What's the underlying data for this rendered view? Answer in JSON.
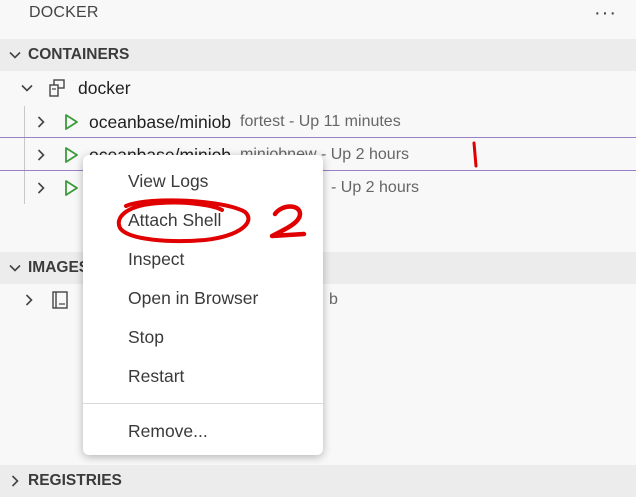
{
  "panel": {
    "title": "DOCKER",
    "more_glyph": "···"
  },
  "sections": {
    "containers": {
      "label": "CONTAINERS"
    },
    "images": {
      "label": "IMAGES"
    },
    "registries": {
      "label": "REGISTRIES"
    }
  },
  "containers_group": {
    "label": "docker"
  },
  "containers": [
    {
      "name": "oceanbase/miniob",
      "desc": "fortest - Up 11 minutes"
    },
    {
      "name": "oceanbase/miniob",
      "desc": "miniobnew - Up 2 hours"
    },
    {
      "name": "",
      "desc": "- Up 2 hours"
    }
  ],
  "images": [
    {
      "name": "",
      "desc": "b"
    }
  ],
  "context_menu": {
    "items": [
      {
        "label": "View Logs"
      },
      {
        "label": "Attach Shell"
      },
      {
        "label": "Inspect"
      },
      {
        "label": "Open in Browser"
      },
      {
        "label": "Stop"
      },
      {
        "label": "Restart"
      }
    ],
    "footer_item": {
      "label": "Remove..."
    }
  },
  "annotations": {
    "mark_1": "1",
    "mark_2": "2"
  },
  "colors": {
    "play_icon": "#3a9b3a",
    "annotation_red": "#e00000",
    "annotation_line": "#9a7fc4"
  }
}
